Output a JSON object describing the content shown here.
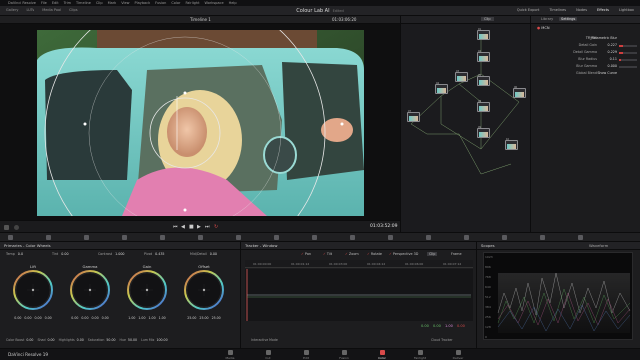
{
  "menu": [
    "DaVinci Resolve",
    "File",
    "Edit",
    "Trim",
    "Timeline",
    "Clip",
    "Mark",
    "View",
    "Playback",
    "Fusion",
    "Color",
    "Fairlight",
    "Workspace",
    "Help"
  ],
  "app": {
    "project_title": "Colour Lab AI",
    "project_status": "Edited",
    "top_left_tools": [
      "Gallery",
      "LUTs",
      "Media Pool",
      "Clips"
    ],
    "top_right_tabs": [
      "Quick Export",
      "Timelines",
      "Nodes",
      "Effects",
      "Lightbox"
    ],
    "active_tab": "Effects"
  },
  "viewer": {
    "timeline_name": "Timeline 1",
    "timecode_top": "01:03:06:20",
    "timecode_bottom": "01:03:52:09"
  },
  "nodes": {
    "tab_clip": "Clip",
    "labels": [
      "01",
      "02",
      "03",
      "04",
      "05",
      "06",
      "07",
      "08",
      "09",
      "10"
    ]
  },
  "inspector": {
    "tabs": [
      "Library",
      "Settings"
    ],
    "active": "Settings",
    "fx_name": "MCN",
    "fields": [
      {
        "label": "MCN",
        "value": "TF_Parametric Blur"
      },
      {
        "label": "Detail Gain",
        "value": "0.227",
        "fill": 0.23
      },
      {
        "label": "Detail Gamma",
        "value": "0.229",
        "fill": 0.23
      },
      {
        "label": "Blur Radius",
        "value": "0.11",
        "fill": 0.11
      },
      {
        "label": "Blur Gamma",
        "value": "0.000",
        "fill": 0.0
      },
      {
        "label": "Global Blend",
        "value": "Show Curve"
      }
    ]
  },
  "primaries": {
    "title": "Primaries - Color Wheels",
    "params": [
      {
        "label": "Temp",
        "value": "0.0"
      },
      {
        "label": "Tint",
        "value": "0.00"
      },
      {
        "label": "Contrast",
        "value": "1.000"
      },
      {
        "label": "Pivot",
        "value": "0.435"
      },
      {
        "label": "Mid/Detail",
        "value": "0.00"
      }
    ],
    "wheels": [
      {
        "name": "Lift",
        "values": "0.00 0.00 0.00 0.00"
      },
      {
        "name": "Gamma",
        "values": "0.00 0.00 0.00 0.00"
      },
      {
        "name": "Gain",
        "values": "1.00 1.00 1.00 1.00"
      },
      {
        "name": "Offset",
        "values": "25.00 25.00 25.00"
      }
    ],
    "footer": [
      {
        "label": "Color Boost",
        "value": "0.00"
      },
      {
        "label": "Shad",
        "value": "0.00"
      },
      {
        "label": "Highlights",
        "value": "0.00"
      },
      {
        "label": "Saturation",
        "value": "50.00"
      },
      {
        "label": "Hue",
        "value": "50.00"
      },
      {
        "label": "Lum Mix",
        "value": "100.00"
      }
    ]
  },
  "tracker": {
    "title": "Tracker - Window",
    "toggles": [
      "Pan",
      "Tilt",
      "Zoom",
      "Rotate",
      "Perspective 3D"
    ],
    "tabs": [
      "Clip",
      "Frame"
    ],
    "ruler": [
      "01:00:00:00",
      "01:00:01:12",
      "01:00:03:00",
      "01:00:04:12",
      "01:00:06:00",
      "01:00:07:12"
    ],
    "readout": [
      "0.00",
      "0.00",
      "1.00",
      "0.00"
    ],
    "bottom_options": [
      "Interactive Mode",
      "Cloud Tracker"
    ]
  },
  "scopes": {
    "title": "Scopes",
    "mode": "Waveform",
    "scale": [
      "1023",
      "896",
      "768",
      "640",
      "512",
      "384",
      "256",
      "128",
      "0"
    ]
  },
  "pages": {
    "brand": "DaVinci Resolve 19",
    "items": [
      "Media",
      "Cut",
      "Edit",
      "Fusion",
      "Color",
      "Fairlight",
      "Deliver"
    ],
    "active": "Color"
  },
  "colors": {
    "accent_red": "#d94a4a",
    "teal_car": "#6fc9c6",
    "tracker_red": "#e05c5c"
  }
}
